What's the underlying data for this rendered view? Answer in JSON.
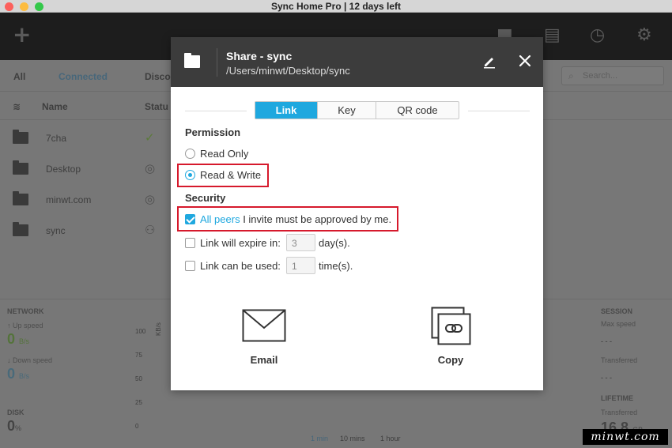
{
  "window": {
    "title": "Sync Home Pro | 12 days left",
    "buttons": {
      "close_color": "#fc605c",
      "minimize_color": "#fdbc40",
      "zoom_color": "#34c84a"
    }
  },
  "toolbar": {
    "icons": [
      "plus-icon",
      "folder-icon",
      "document-icon",
      "clock-icon",
      "gear-icon"
    ],
    "add_glyph": "+",
    "folder_glyph": "■",
    "document_glyph": "▤",
    "clock_glyph": "◷",
    "gear_glyph": "⚙"
  },
  "filters": {
    "all": "All",
    "connected": "Connected",
    "disconnected": "Disco",
    "search_placeholder": "Search..."
  },
  "columns": {
    "name": "Name",
    "status": "Statu"
  },
  "folders": [
    {
      "name": "7cha",
      "status_glyph": "✓"
    },
    {
      "name": "Desktop",
      "status_glyph": "◎"
    },
    {
      "name": "minwt.com",
      "status_glyph": "◎"
    },
    {
      "name": "sync",
      "status_glyph": "⚇"
    }
  ],
  "network": {
    "heading": "NETWORK",
    "up_label": "↑ Up speed",
    "up_value": "0",
    "up_unit": "B/s",
    "down_label": "↓ Down speed",
    "down_value": "0",
    "down_unit": "B/s",
    "disk_heading": "DISK",
    "disk_value": "0",
    "disk_unit": "%"
  },
  "graph": {
    "y_ticks": [
      "100",
      "75",
      "50",
      "25",
      "0"
    ],
    "y_unit": "KB/s",
    "ranges": [
      "1 min",
      "10 mins",
      "1 hour"
    ],
    "active_range": "1 min"
  },
  "session": {
    "heading": "SESSION",
    "max_speed_label": "Max speed",
    "max_speed_value": "- - -",
    "transferred_label": "Transferred",
    "transferred_value": "- - -",
    "lifetime_heading": "LIFETIME",
    "lifetime_transferred_label": "Transferred",
    "lifetime_value": "16.8",
    "lifetime_unit": "GB"
  },
  "share_dialog": {
    "title": "Share - sync",
    "path": "/Users/minwt/Desktop/sync",
    "tabs": [
      {
        "label": "Link",
        "active": true
      },
      {
        "label": "Key",
        "active": false
      },
      {
        "label": "QR code",
        "active": false
      }
    ],
    "permission_heading": "Permission",
    "permissions": [
      {
        "label": "Read Only",
        "selected": false
      },
      {
        "label": "Read & Write",
        "selected": true
      }
    ],
    "security_heading": "Security",
    "approve": {
      "checked": true,
      "highlight": "All peers",
      "rest": " I invite must be approved by me."
    },
    "expire": {
      "checked": false,
      "label": "Link will expire in:",
      "value": "3",
      "unit": "day(s)."
    },
    "uses": {
      "checked": false,
      "label": "Link can be used:",
      "value": "1",
      "unit": "time(s)."
    },
    "actions": [
      {
        "label": "Email",
        "icon": "envelope-icon"
      },
      {
        "label": "Copy",
        "icon": "copy-link-icon"
      }
    ],
    "accent_color": "#1fa8df",
    "highlight_color": "#d6192c"
  },
  "watermark": "minwt.com"
}
